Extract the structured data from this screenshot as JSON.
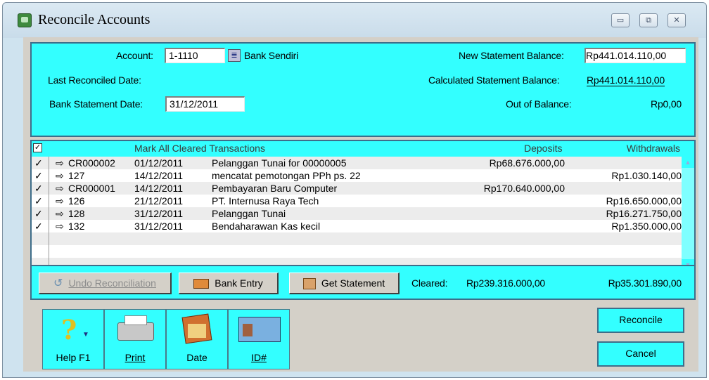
{
  "window": {
    "title": "Reconcile Accounts",
    "controls": [
      "minimize",
      "restore",
      "close"
    ]
  },
  "header": {
    "account_label": "Account:",
    "account_code": "1-1110",
    "account_name": "Bank Sendiri",
    "last_reconciled_label": "Last Reconciled Date:",
    "bank_statement_label": "Bank Statement Date:",
    "bank_statement_date": "31/12/2011",
    "new_balance_label": "New Statement Balance:",
    "new_balance_value": "Rp441.014.110,00",
    "calc_balance_label": "Calculated Statement Balance:",
    "calc_balance_value": "Rp441.014.110,00",
    "out_of_balance_label": "Out of Balance:",
    "out_of_balance_value": "Rp0,00"
  },
  "table": {
    "mark_all_label": "Mark All Cleared Transactions",
    "deposits_header": "Deposits",
    "withdrawals_header": "Withdrawals",
    "rows": [
      {
        "check": "✓",
        "arrow": "⇨",
        "id": "CR000002",
        "date": "01/12/2011",
        "memo": "Pelanggan Tunai for 00000005",
        "deposit": "Rp68.676.000,00",
        "withdrawal": ""
      },
      {
        "check": "✓",
        "arrow": "⇨",
        "id": "127",
        "date": "14/12/2011",
        "memo": "mencatat pemotongan PPh ps. 22",
        "deposit": "",
        "withdrawal": "Rp1.030.140,00"
      },
      {
        "check": "✓",
        "arrow": "⇨",
        "id": "CR000001",
        "date": "14/12/2011",
        "memo": "Pembayaran Baru Computer",
        "deposit": "Rp170.640.000,00",
        "withdrawal": ""
      },
      {
        "check": "✓",
        "arrow": "⇨",
        "id": "126",
        "date": "21/12/2011",
        "memo": "PT. Internusa Raya Tech",
        "deposit": "",
        "withdrawal": "Rp16.650.000,00"
      },
      {
        "check": "✓",
        "arrow": "⇨",
        "id": "128",
        "date": "31/12/2011",
        "memo": "Pelanggan Tunai",
        "deposit": "",
        "withdrawal": "Rp16.271.750,00"
      },
      {
        "check": "✓",
        "arrow": "⇨",
        "id": "132",
        "date": "31/12/2011",
        "memo": "Bendaharawan Kas kecil",
        "deposit": "",
        "withdrawal": "Rp1.350.000,00"
      }
    ]
  },
  "actions": {
    "undo_label": "Undo Reconciliation",
    "bank_entry_label": "Bank Entry",
    "get_statement_label": "Get Statement",
    "cleared_label": "Cleared:",
    "cleared_deposits": "Rp239.316.000,00",
    "cleared_withdrawals": "Rp35.301.890,00"
  },
  "toolbar": {
    "help_label": "Help F1",
    "print_label": "Print",
    "date_label": "Date",
    "id_label": "ID#"
  },
  "footer": {
    "reconcile_label": "Reconcile",
    "cancel_label": "Cancel"
  },
  "colors": {
    "panel": "#33ffff",
    "dialog": "#d4d0c8",
    "titlebar": "#cfe3ef"
  }
}
